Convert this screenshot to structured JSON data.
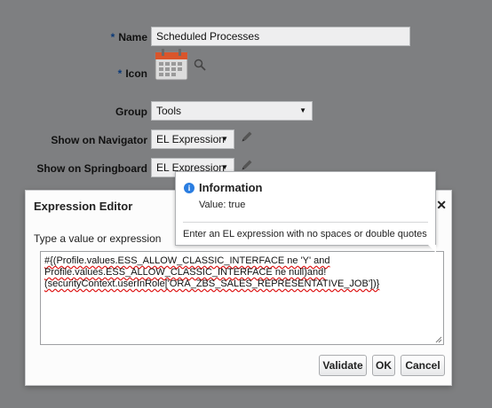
{
  "form": {
    "name": {
      "required": "*",
      "label": "Name",
      "value": "Scheduled Processes"
    },
    "icon": {
      "required": "*",
      "label": "Icon"
    },
    "group": {
      "label": "Group",
      "value": "Tools"
    },
    "show_on_navigator": {
      "label": "Show on Navigator",
      "value": "EL Expression"
    },
    "show_on_springboard": {
      "label": "Show on Springboard",
      "value": "EL Expression"
    }
  },
  "dialog": {
    "title": "Expression Editor",
    "close": "✕",
    "expression_label": "Type a value or expression",
    "expression_lines": [
      "#{(Profile.values.ESS_ALLOW_CLASSIC_INTERFACE ne 'Y' and",
      "Profile.values.ESS_ALLOW_CLASSIC_INTERFACE ne null)and!",
      "(securityContext.userInRole['ORA_ZBS_SALES_REPRESENTATIVE_JOB'])}"
    ],
    "buttons": {
      "validate": "Validate",
      "ok": "OK",
      "cancel": "Cancel"
    }
  },
  "info_popup": {
    "title": "Information",
    "value_text": "Value: true",
    "hint": "Enter an EL expression with no spaces or double quotes"
  },
  "colors": {
    "accent": "#2a7de1",
    "overlay": "#7e7f81",
    "required": "#0b3a78"
  }
}
